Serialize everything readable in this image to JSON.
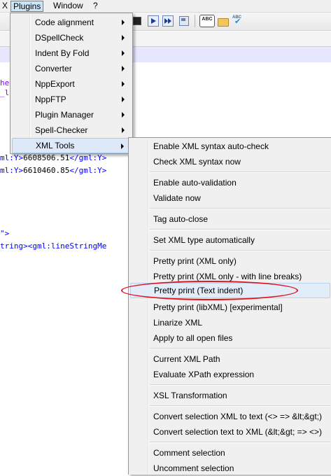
{
  "menubar": {
    "items": [
      "X",
      "Plugins",
      "Window",
      "?"
    ]
  },
  "toolbar": {
    "icons": [
      "stop-record-icon",
      "play-macro-icon",
      "run-macro-multiple-icon",
      "save-macro-icon",
      "spellcheck-abc-icon",
      "folder-icon",
      "spellcheck-auto-icon"
    ],
    "spell_label": "ABC",
    "spell_check_label": "ABC"
  },
  "editor": {
    "line1": "he",
    "line2": "_l",
    "line3": {
      "tag_open": "ml:Y>",
      "value": "6608506.51",
      "tag_close": "</gml:Y>"
    },
    "line4": {
      "tag_open": "ml:Y>",
      "value": "6610460.85",
      "tag_close": "</gml:Y>"
    },
    "line5": "\">",
    "line6": "tring><gml:lineStringMe"
  },
  "plugins_menu": {
    "items": [
      {
        "label": "Code alignment"
      },
      {
        "label": "DSpellCheck"
      },
      {
        "label": "Indent By Fold"
      },
      {
        "label": "Converter"
      },
      {
        "label": "NppExport"
      },
      {
        "label": "NppFTP"
      },
      {
        "label": "Plugin Manager"
      },
      {
        "label": "Spell-Checker"
      },
      {
        "label": "XML Tools"
      }
    ],
    "active": "XML Tools"
  },
  "xml_tools_menu": {
    "items": [
      "Enable XML syntax auto-check",
      "Check XML syntax now",
      "Enable auto-validation",
      "Validate now",
      "Tag auto-close",
      "Set XML type automatically",
      "Pretty print (XML only)",
      "Pretty print (XML only - with line breaks)",
      "Pretty print (Text indent)",
      "Pretty print (libXML) [experimental]",
      "Linarize XML",
      "Apply to all open files",
      "Current XML Path",
      "Evaluate XPath expression",
      "XSL Transformation",
      "Convert selection XML to text (<> => &lt;&gt;)",
      "Convert selection text to XML (&lt;&gt; => <>)",
      "Comment selection",
      "Uncomment selection"
    ],
    "highlighted": "Pretty print (Text indent)"
  },
  "colors": {
    "menu_bg": "#f0f0f0",
    "highlight": "#dde9f8",
    "annotation": "#e0141e",
    "xml_tag": "#0000ff"
  }
}
